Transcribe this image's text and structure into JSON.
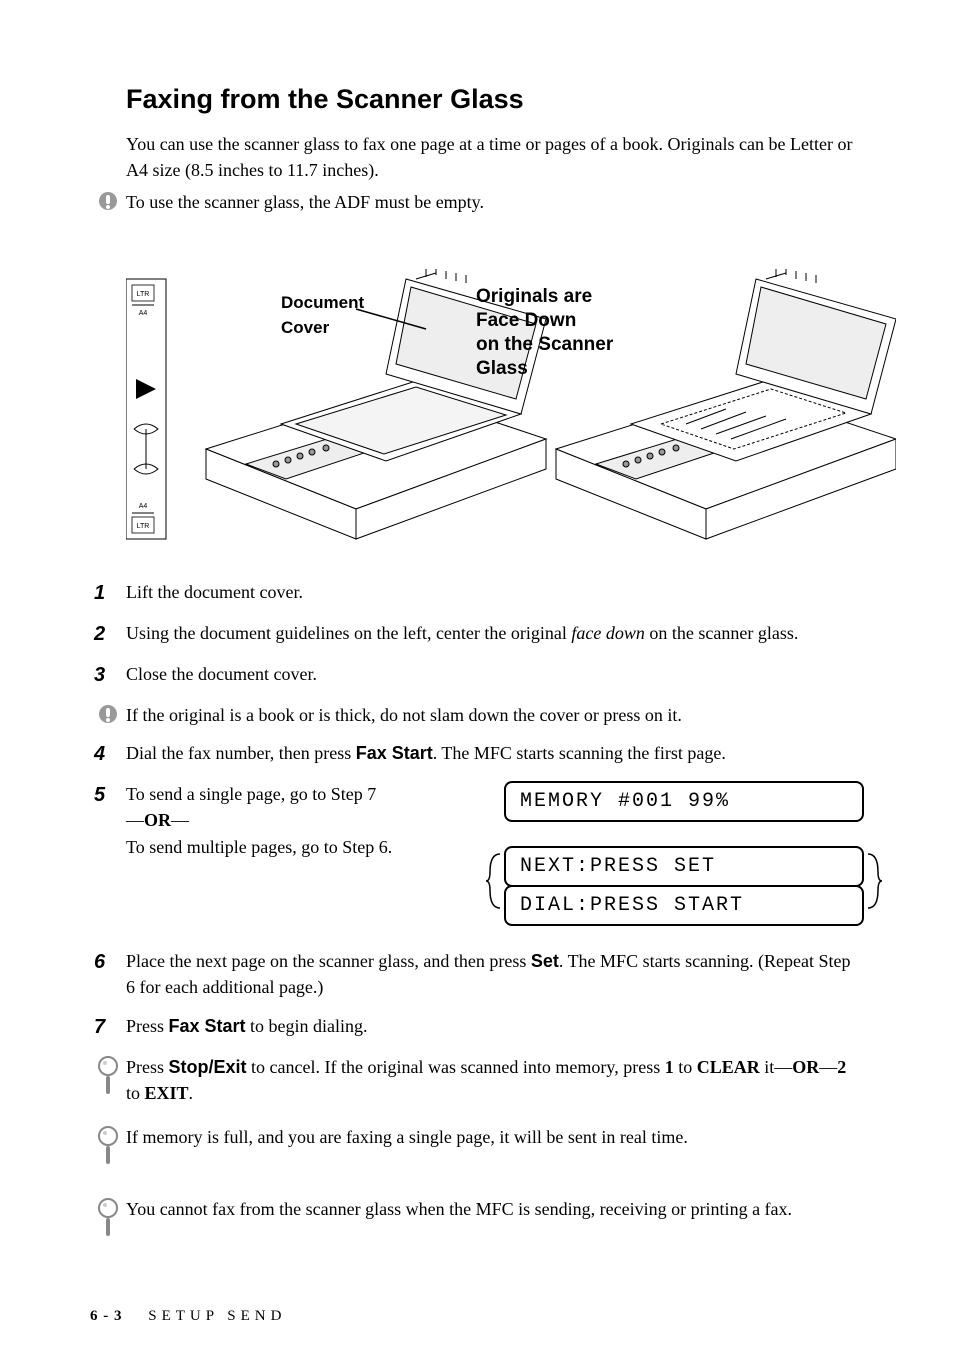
{
  "heading": "Faxing from the Scanner Glass",
  "intro": "You can use the scanner glass to fax one page at a time or pages of a book. Originals can be Letter or A4 size (8.5 inches to 11.7 inches).",
  "alert_adf": "To use the scanner glass, the ADF must be empty.",
  "illustration": {
    "label_cover_1": "Document",
    "label_cover_2": "Cover",
    "label_orig_1": "Originals are",
    "label_orig_2": "Face Down",
    "label_orig_3": "on the Scanner",
    "label_orig_4": "Glass",
    "ltr": "LTR",
    "a4": "A4"
  },
  "step1": "Lift the document cover.",
  "step2_pre": "Using the document guidelines on the left, center the original ",
  "step2_italic": "face down",
  "step2_post": " on the scanner glass.",
  "step3": "Close the document cover.",
  "alert_book": "If the original is a book or is thick, do not slam down the cover or press on it.",
  "step4_pre": "Dial the fax number, then press ",
  "step4_bold": "Fax Start",
  "step4_post": ". The MFC starts scanning the first page.",
  "step5_line1": "To send a single page, go to Step 7",
  "step5_or_dash1": "—",
  "step5_or": "OR",
  "step5_or_dash2": "—",
  "step5_line3": "To send multiple pages, go to Step 6.",
  "lcd_memory": "MEMORY #001 99%",
  "lcd_next": "NEXT:PRESS SET",
  "lcd_dial": "DIAL:PRESS START",
  "step6_pre": "Place the next page on the scanner glass, and then press ",
  "step6_bold": "Set",
  "step6_post": ". The MFC starts scanning. (Repeat Step 6 for each additional page.)",
  "step7_pre": "Press ",
  "step7_bold": "Fax Start",
  "step7_post": " to begin dialing.",
  "tip1_pre": "Press ",
  "tip1_stop": "Stop/Exit",
  "tip1_mid1": " to cancel.  If the original was scanned into memory, press ",
  "tip1_one": "1",
  "tip1_mid2": " to ",
  "tip1_clear": "CLEAR",
  "tip1_mid3": " it—",
  "tip1_or": "OR",
  "tip1_mid4": "—",
  "tip1_two": "2",
  "tip1_mid5": " to ",
  "tip1_exit": "EXIT",
  "tip1_end": ".",
  "tip2": "If memory is full, and you are faxing a single page, it will be sent in real time.",
  "tip3": "You cannot fax from the scanner glass when the MFC is sending, receiving or printing a fax.",
  "footer_page": "6 - 3",
  "footer_section": "SETUP SEND"
}
